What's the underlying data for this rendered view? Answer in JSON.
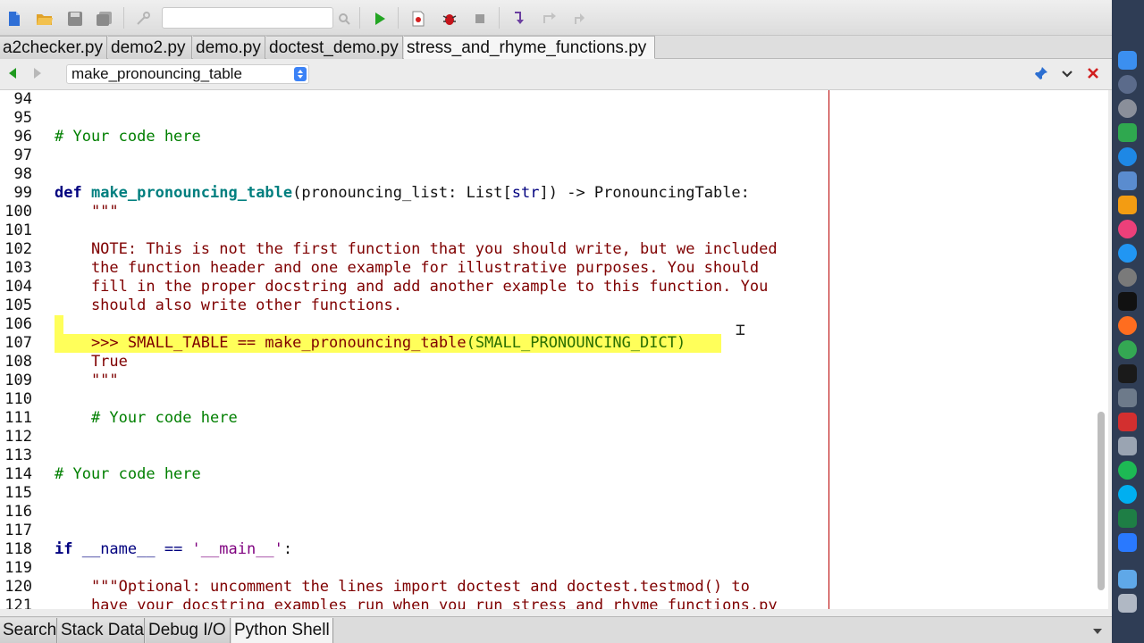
{
  "toolbar": {
    "search_value": "",
    "icons": [
      "new-file-icon",
      "open-folder-icon",
      "save-icon",
      "save-all-icon",
      "run-icon",
      "debug-icon",
      "stop-icon",
      "step-into-icon",
      "step-over-icon",
      "step-out-icon"
    ]
  },
  "file_tabs": [
    {
      "label": "a2checker.py",
      "active": false
    },
    {
      "label": "demo2.py",
      "active": false
    },
    {
      "label": "demo.py",
      "active": false
    },
    {
      "label": "doctest_demo.py",
      "active": false
    },
    {
      "label": "stress_and_rhyme_functions.py",
      "active": true
    }
  ],
  "navbar": {
    "function_select": "make_pronouncing_table"
  },
  "editor": {
    "line_numbers": [
      "94",
      "95",
      "96",
      "97",
      "98",
      "99",
      "100",
      "101",
      "102",
      "103",
      "104",
      "105",
      "106",
      "107",
      "108",
      "109",
      "110",
      "111",
      "112",
      "113",
      "114",
      "115",
      "116",
      "117",
      "118",
      "119",
      "120",
      "121"
    ],
    "lines": {
      "l96": "# Your code here",
      "l99_def": "def",
      "l99_fn": "make_pronouncing_table",
      "l99_a": "(pronouncing_list: List[",
      "l99_b": "str",
      "l99_c": "]) -> PronouncingTable:",
      "l100": "    \"\"\"",
      "l102": "    NOTE: This is not the first function that you should write, but we included",
      "l103": "    the function header and one example for illustrative purposes. You should",
      "l104": "    fill in the proper docstring and add another example to this function. You",
      "l105": "    should also write other functions.",
      "l107_a": "    >>> SMALL_TABLE == make_pronouncing_table",
      "l107_b": "(SMALL_PRONOUNCING_DICT)",
      "l108": "    True",
      "l109": "    \"\"\"",
      "l111": "    # Your code here",
      "l114": "# Your code here",
      "l118_if": "if",
      "l118_a": " __name__ == ",
      "l118_str": "'__main__'",
      "l118_b": ":",
      "l120": "    \"\"\"Optional: uncomment the lines import doctest and doctest.testmod() to",
      "l121": "    have your docstring examples run when you run stress_and_rhyme_functions.py"
    }
  },
  "bottom_tabs": [
    {
      "label": "Search",
      "active": false
    },
    {
      "label": "Stack Data",
      "active": false
    },
    {
      "label": "Debug I/O",
      "active": false
    },
    {
      "label": "Python Shell",
      "active": true
    }
  ],
  "colors": {
    "keyword": "#00007f",
    "function": "#007f7f",
    "comment": "#007f00",
    "docstring": "#7f0000",
    "string": "#7f007f",
    "highlight": "#ffff5a",
    "margin_line": "#b80000"
  }
}
